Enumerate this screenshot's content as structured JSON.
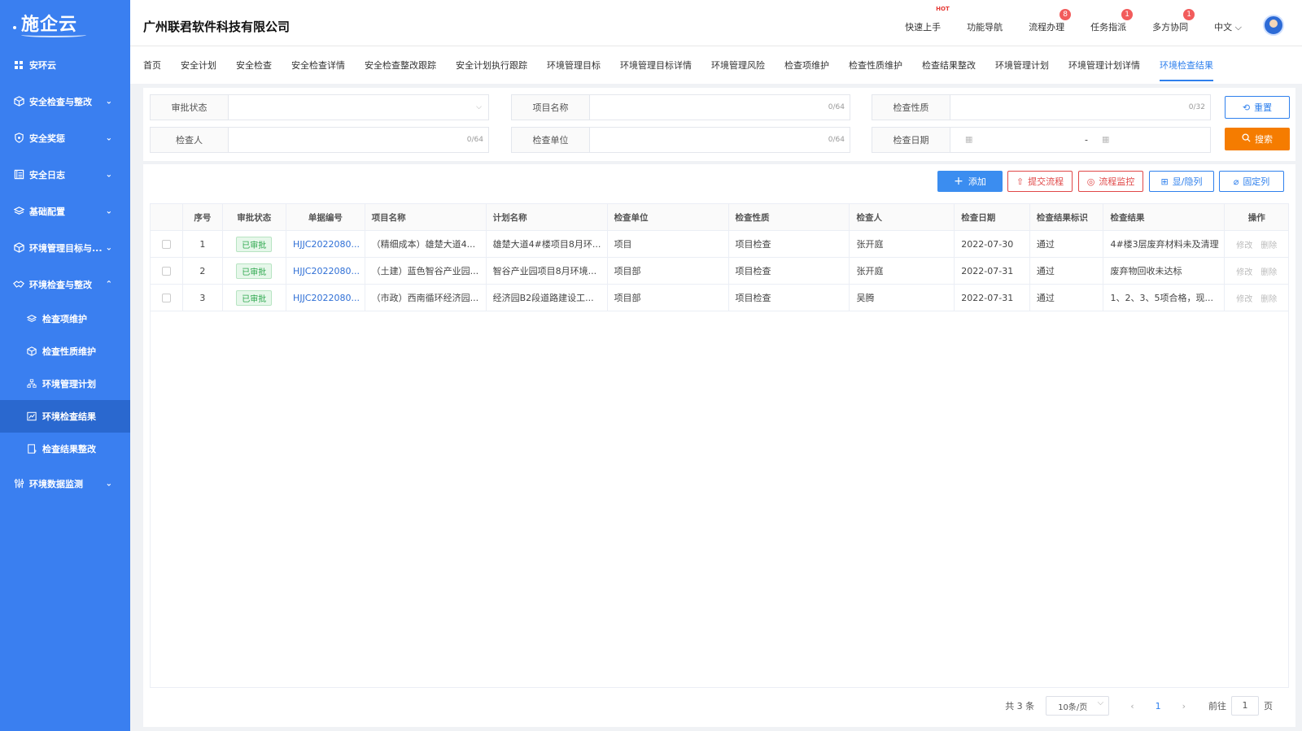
{
  "sidebar": {
    "logo": "施企云",
    "top_item": "安环云",
    "items": [
      {
        "label": "安全检查与整改",
        "icon": "cube-icon",
        "chev": "⌄"
      },
      {
        "label": "安全奖惩",
        "icon": "shield-icon",
        "chev": "⌄"
      },
      {
        "label": "安全日志",
        "icon": "log-icon",
        "chev": "⌄"
      },
      {
        "label": "基础配置",
        "icon": "layers-icon",
        "chev": "⌄"
      },
      {
        "label": "环境管理目标与...",
        "icon": "cube-icon",
        "chev": "⌄"
      },
      {
        "label": "环境检查与整改",
        "icon": "hands-icon",
        "chev": "⌃"
      }
    ],
    "sub_items": [
      {
        "label": "检查项维护",
        "icon": "layers-icon"
      },
      {
        "label": "检查性质维护",
        "icon": "cube-icon"
      },
      {
        "label": "环境管理计划",
        "icon": "org-icon"
      },
      {
        "label": "环境检查结果",
        "icon": "chart-icon"
      },
      {
        "label": "检查结果整改",
        "icon": "doc-icon"
      }
    ],
    "bottom_item": {
      "label": "环境数据监测",
      "icon": "monitor-icon",
      "chev": "⌄"
    }
  },
  "header": {
    "company": "广州联君软件科技有限公司",
    "nav": [
      {
        "label": "快速上手",
        "hot": "HOT"
      },
      {
        "label": "功能导航"
      },
      {
        "label": "流程办理",
        "badge": "8"
      },
      {
        "label": "任务指派",
        "badge": "1"
      },
      {
        "label": "多方协同",
        "badge": "1"
      }
    ],
    "lang": "中文 ⌵"
  },
  "tabs": [
    {
      "label": "首页"
    },
    {
      "label": "安全计划"
    },
    {
      "label": "安全检查"
    },
    {
      "label": "安全检查详情"
    },
    {
      "label": "安全检查整改跟踪"
    },
    {
      "label": "安全计划执行跟踪"
    },
    {
      "label": "环境管理目标"
    },
    {
      "label": "环境管理目标详情"
    },
    {
      "label": "环境管理风险"
    },
    {
      "label": "检查项维护"
    },
    {
      "label": "检查性质维护"
    },
    {
      "label": "检查结果整改"
    },
    {
      "label": "环境管理计划"
    },
    {
      "label": "环境管理计划详情"
    },
    {
      "label": "环境检查结果",
      "active": true
    }
  ],
  "search": {
    "approval_status_label": "审批状态",
    "project_name_label": "项目名称",
    "project_name_count": "0/64",
    "check_nature_label": "检查性质",
    "check_nature_count": "0/32",
    "inspector_label": "检查人",
    "inspector_count": "0/64",
    "check_unit_label": "检查单位",
    "check_unit_count": "0/64",
    "check_date_label": "检查日期",
    "date_sep": "-",
    "reset_label": "重置",
    "search_label": "搜索"
  },
  "toolbar": {
    "add_label": "添加",
    "submit_label": "提交流程",
    "monitor_label": "流程监控",
    "toggle_cols_label": "显/隐列",
    "fixed_cols_label": "固定列"
  },
  "table": {
    "columns": [
      "序号",
      "审批状态",
      "单据编号",
      "项目名称",
      "计划名称",
      "检查单位",
      "检查性质",
      "检查人",
      "检查日期",
      "检查结果标识",
      "检查结果",
      "操作"
    ],
    "rows": [
      {
        "no": "1",
        "status": "已审批",
        "code": "HJJC2022080...",
        "project": "（精细成本）雄楚大道4...",
        "plan": "雄楚大道4#楼项目8月环...",
        "unit": "项目",
        "nature": "项目检查",
        "inspector": "张开庭",
        "date": "2022-07-30",
        "flag": "通过",
        "result": "4#楼3层废弃材料未及清理"
      },
      {
        "no": "2",
        "status": "已审批",
        "code": "HJJC2022080...",
        "project": "（土建）蓝色智谷产业园...",
        "plan": "智谷产业园项目8月环境...",
        "unit": "项目部",
        "nature": "项目检查",
        "inspector": "张开庭",
        "date": "2022-07-31",
        "flag": "通过",
        "result": "废弃物回收未达标"
      },
      {
        "no": "3",
        "status": "已审批",
        "code": "HJJC2022080...",
        "project": "（市政）西南循环经济园...",
        "plan": "经济园B2段道路建设工...",
        "unit": "项目部",
        "nature": "项目检查",
        "inspector": "吴腾",
        "date": "2022-07-31",
        "flag": "通过",
        "result": "1、2、3、5项合格，现..."
      }
    ],
    "op_edit": "修改",
    "op_delete": "删除"
  },
  "pager": {
    "total": "共 3 条",
    "size": "10条/页",
    "prev": "‹",
    "page": "1",
    "next": "›",
    "goto": "前往",
    "goto_value": "1",
    "goto_suffix": "页"
  }
}
